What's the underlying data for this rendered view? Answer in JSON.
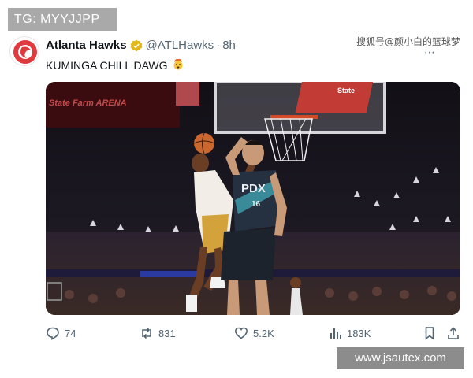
{
  "overlay": {
    "tg_text": "TG: MYYJJPP"
  },
  "tweet": {
    "author_name": "Atlanta Hawks",
    "handle": "@ATLHawks",
    "separator": "·",
    "time": "8h",
    "text": "KUMINGA CHILL DAWG",
    "emoji_icon": "exploding-head-icon",
    "avatar_icon": "hawks-logo-icon",
    "verified_icon": "gold-verified-badge-icon"
  },
  "watermark_top": "搜狐号@颜小白的篮球梦",
  "media": {
    "arena_text": "State Farm ARENA",
    "jersey_text": "PDX",
    "jersey_number": "16",
    "board_text": "State"
  },
  "actions": {
    "reply_count": "74",
    "repost_count": "831",
    "like_count": "5.2K",
    "views_count": "183K"
  },
  "watermark_bottom": "www.jsautex.com",
  "colors": {
    "hawks_red": "#e03a3e",
    "text_primary": "#0f1419",
    "text_secondary": "#536471",
    "verified_gold": "#e2b719"
  }
}
